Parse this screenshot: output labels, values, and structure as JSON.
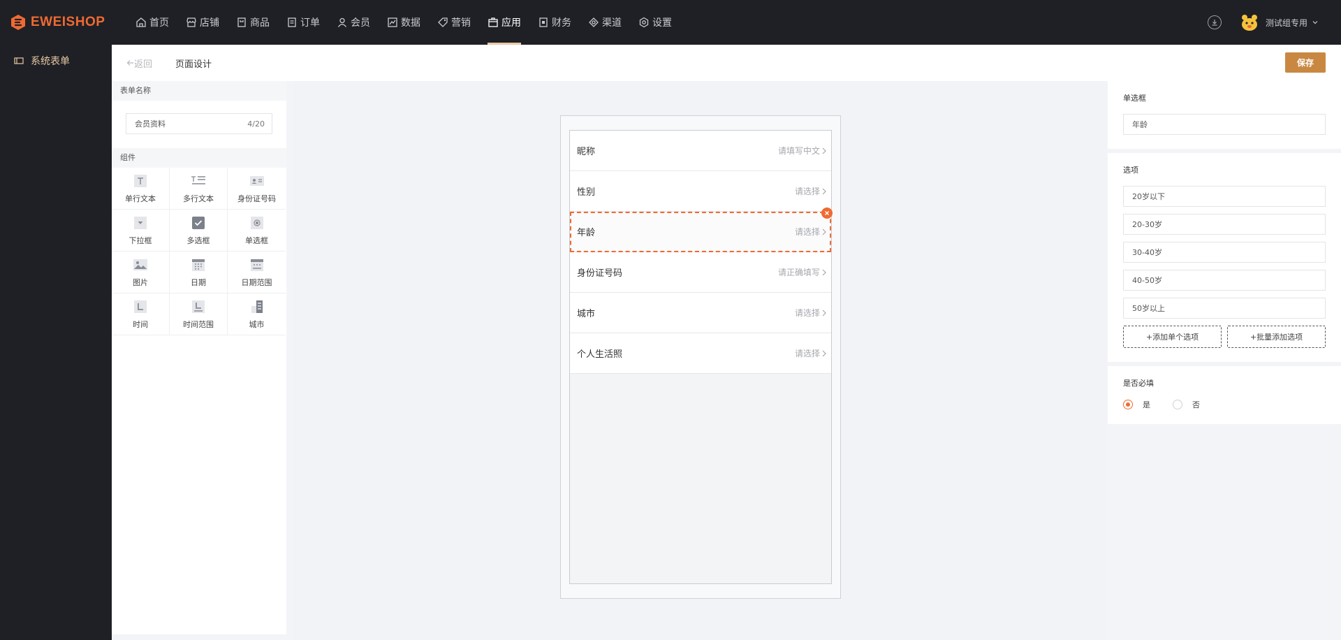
{
  "brand": {
    "name": "EWEISHOP",
    "accent": "#ef6a32"
  },
  "nav": [
    {
      "label": "首页",
      "icon": "home-icon"
    },
    {
      "label": "店铺",
      "icon": "store-icon"
    },
    {
      "label": "商品",
      "icon": "goods-icon"
    },
    {
      "label": "订单",
      "icon": "order-icon"
    },
    {
      "label": "会员",
      "icon": "member-icon"
    },
    {
      "label": "数据",
      "icon": "chart-icon"
    },
    {
      "label": "营销",
      "icon": "tag-icon"
    },
    {
      "label": "应用",
      "icon": "app-icon",
      "active": true
    },
    {
      "label": "财务",
      "icon": "finance-icon"
    },
    {
      "label": "渠道",
      "icon": "channel-icon"
    },
    {
      "label": "设置",
      "icon": "settings-icon"
    }
  ],
  "user": {
    "name": "测试组专用"
  },
  "sidebar": {
    "items": [
      {
        "label": "系统表单",
        "icon": "form-icon"
      }
    ]
  },
  "header": {
    "back_label": "返回",
    "title": "页面设计",
    "save_label": "保存"
  },
  "left_panel": {
    "form_name_title": "表单名称",
    "form_name_value": "会员资料",
    "form_name_count": "4/20",
    "components_title": "组件",
    "components": [
      {
        "label": "单行文本",
        "icon": "single-text-icon"
      },
      {
        "label": "多行文本",
        "icon": "multi-text-icon"
      },
      {
        "label": "身份证号码",
        "icon": "id-card-icon"
      },
      {
        "label": "下拉框",
        "icon": "dropdown-icon"
      },
      {
        "label": "多选框",
        "icon": "checkbox-icon"
      },
      {
        "label": "单选框",
        "icon": "radio-icon"
      },
      {
        "label": "图片",
        "icon": "image-icon"
      },
      {
        "label": "日期",
        "icon": "calendar-icon"
      },
      {
        "label": "日期范围",
        "icon": "calendar-range-icon"
      },
      {
        "label": "时间",
        "icon": "time-icon"
      },
      {
        "label": "时间范围",
        "icon": "time-range-icon"
      },
      {
        "label": "城市",
        "icon": "city-icon"
      }
    ]
  },
  "preview": {
    "fields": [
      {
        "label": "昵称",
        "hint": "请填写中文"
      },
      {
        "label": "性别",
        "hint": "请选择"
      },
      {
        "label": "年龄",
        "hint": "请选择",
        "selected": true
      },
      {
        "label": "身份证号码",
        "hint": "请正确填写"
      },
      {
        "label": "城市",
        "hint": "请选择"
      },
      {
        "label": "个人生活照",
        "hint": "请选择"
      }
    ]
  },
  "right_panel": {
    "type_title": "单选框",
    "field_name": "年龄",
    "options_title": "选项",
    "options": [
      "20岁以下",
      "20-30岁",
      "30-40岁",
      "40-50岁",
      "50岁以上"
    ],
    "add_single_label": "+添加单个选项",
    "add_batch_label": "+批量添加选项",
    "required_title": "是否必填",
    "required_yes": "是",
    "required_no": "否",
    "required_value": "是"
  }
}
